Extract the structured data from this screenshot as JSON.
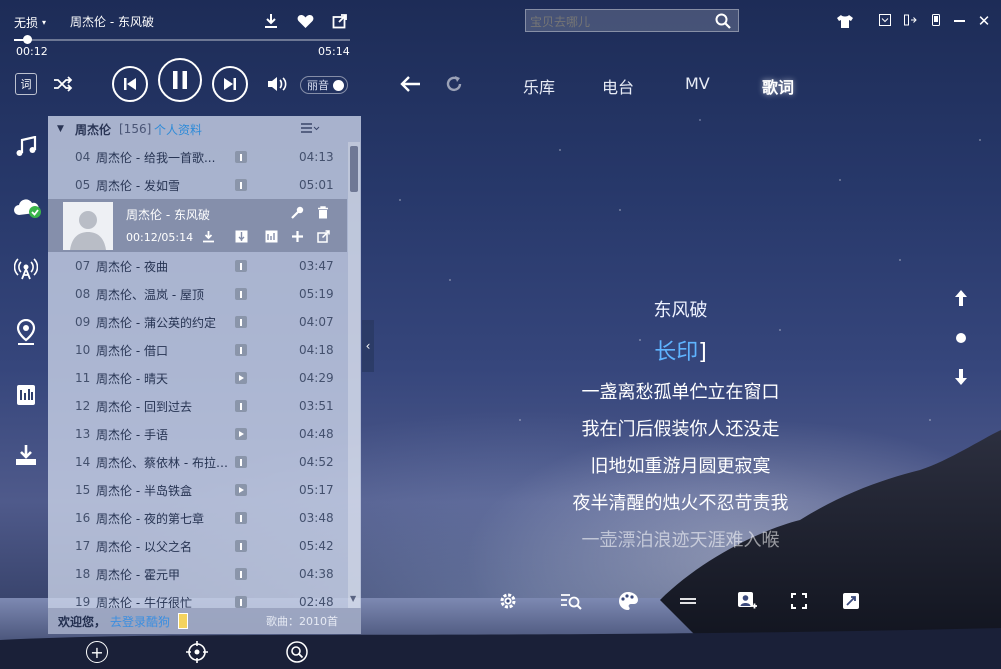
{
  "player": {
    "quality": "无损",
    "now_playing": "周杰伦 - 东风破",
    "elapsed": "00:12",
    "duration": "05:14",
    "progress": 0.04,
    "lyric_button": "词",
    "ambient_toggle": "丽音",
    "search_placeholder": "宝贝去哪儿"
  },
  "nav": {
    "tabs": [
      "乐库",
      "电台",
      "MV",
      "歌词"
    ],
    "active": "歌词"
  },
  "playlist": {
    "name": "周杰伦",
    "count": "[156]",
    "status": "个人资料",
    "current": {
      "title": "周杰伦 - 东风破",
      "time": "00:12/05:14"
    },
    "rows_before": [
      {
        "num": "04",
        "title": "周杰伦 - 给我一首歌...",
        "duration": "04:13",
        "mark": "mv"
      },
      {
        "num": "05",
        "title": "周杰伦 - 发如雪",
        "duration": "05:01",
        "mark": "mv"
      }
    ],
    "rows_after": [
      {
        "num": "07",
        "title": "周杰伦 - 夜曲",
        "duration": "03:47",
        "mark": "mv"
      },
      {
        "num": "08",
        "title": "周杰伦、温岚 - 屋顶",
        "duration": "05:19",
        "mark": "mv"
      },
      {
        "num": "09",
        "title": "周杰伦 - 蒲公英的约定",
        "duration": "04:07",
        "mark": "mv"
      },
      {
        "num": "10",
        "title": "周杰伦 - 借口",
        "duration": "04:18",
        "mark": "mv"
      },
      {
        "num": "11",
        "title": "周杰伦 - 晴天",
        "duration": "04:29",
        "mark": "play"
      },
      {
        "num": "12",
        "title": "周杰伦 - 回到过去",
        "duration": "03:51",
        "mark": "mv"
      },
      {
        "num": "13",
        "title": "周杰伦 - 手语",
        "duration": "04:48",
        "mark": "play"
      },
      {
        "num": "14",
        "title": "周杰伦、蔡依林 - 布拉格广场",
        "duration": "04:52",
        "mark": "mv"
      },
      {
        "num": "15",
        "title": "周杰伦 - 半岛铁盒",
        "duration": "05:17",
        "mark": "play"
      },
      {
        "num": "16",
        "title": "周杰伦 - 夜的第七章",
        "duration": "03:48",
        "mark": "mv"
      },
      {
        "num": "17",
        "title": "周杰伦 - 以父之名",
        "duration": "05:42",
        "mark": "mv"
      },
      {
        "num": "18",
        "title": "周杰伦 - 霍元甲",
        "duration": "04:38",
        "mark": "mv"
      },
      {
        "num": "19",
        "title": "周杰伦 - 牛仔很忙",
        "duration": "02:48",
        "mark": "mv"
      }
    ],
    "footer_welcome": "欢迎您，",
    "footer_user": "去登录酷狗",
    "footer_count": "歌曲：2010首"
  },
  "lyrics": {
    "title": "东风破",
    "current": "长印",
    "lines": [
      "一盏离愁孤单伫立在窗口",
      "我在门后假装你人还没走",
      "旧地如重游月圆更寂寞",
      "夜半清醒的烛火不忍苛责我",
      "一壶漂泊浪迹天涯难入喉"
    ]
  }
}
